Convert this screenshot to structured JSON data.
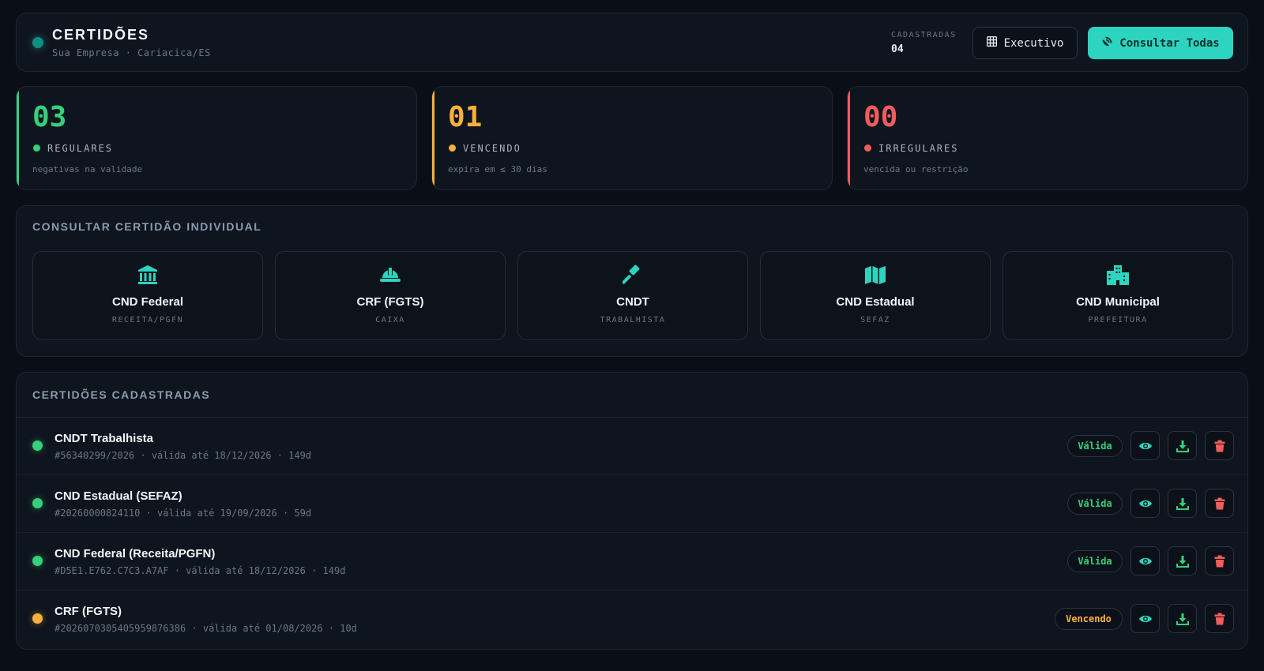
{
  "header": {
    "title": "CERTIDÕES",
    "subtitle": "Sua Empresa · Cariacica/ES",
    "registered_label": "CADASTRADAS",
    "registered_count": "04",
    "exec_button": "Executivo",
    "consult_button": "Consultar Todas"
  },
  "stats": [
    {
      "value": "03",
      "label": "REGULARES",
      "desc": "negativas na validade",
      "color": "#34d17b"
    },
    {
      "value": "01",
      "label": "VENCENDO",
      "desc": "expira em ≤ 30 dias",
      "color": "#fbb03b"
    },
    {
      "value": "00",
      "label": "IRREGULARES",
      "desc": "vencida ou restrição",
      "color": "#f25c5c"
    }
  ],
  "individual": {
    "title": "CONSULTAR CERTIDÃO INDIVIDUAL",
    "cards": [
      {
        "name": "CND Federal",
        "source": "RECEITA/PGFN",
        "icon": "bank-icon"
      },
      {
        "name": "CRF (FGTS)",
        "source": "CAIXA",
        "icon": "hard-hat-icon"
      },
      {
        "name": "CNDT",
        "source": "TRABALHISTA",
        "icon": "gavel-icon"
      },
      {
        "name": "CND Estadual",
        "source": "SEFAZ",
        "icon": "map-icon"
      },
      {
        "name": "CND Municipal",
        "source": "PREFEITURA",
        "icon": "city-icon"
      }
    ]
  },
  "registered": {
    "title": "CERTIDÕES CADASTRADAS",
    "rows": [
      {
        "name": "CNDT Trabalhista",
        "meta": "#56340299/2026 · válida até 18/12/2026 · 149d",
        "status": "Válida",
        "status_color": "#34d17b"
      },
      {
        "name": "CND Estadual (SEFAZ)",
        "meta": "#20260000824110 · válida até 19/09/2026 · 59d",
        "status": "Válida",
        "status_color": "#34d17b"
      },
      {
        "name": "CND Federal (Receita/PGFN)",
        "meta": "#D5E1.E762.C7C3.A7AF · válida até 18/12/2026 · 149d",
        "status": "Válida",
        "status_color": "#34d17b"
      },
      {
        "name": "CRF (FGTS)",
        "meta": "#2026070305405959876386 · válida até 01/08/2026 · 10d",
        "status": "Vencendo",
        "status_color": "#fbb03b"
      }
    ]
  },
  "colors": {
    "accent": "#2dd4bf",
    "valid": "#34d17b",
    "warning": "#fbb03b",
    "danger": "#f25c5c"
  }
}
